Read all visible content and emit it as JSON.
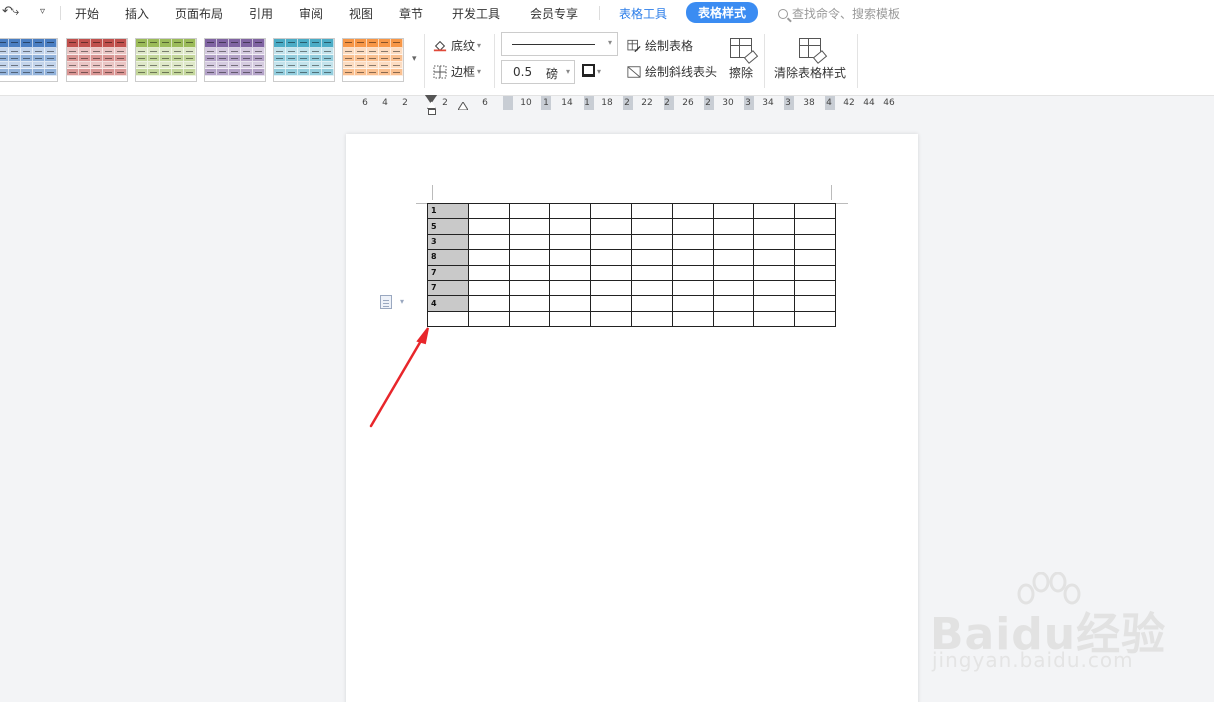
{
  "menu": {
    "items": [
      "开始",
      "插入",
      "页面布局",
      "引用",
      "审阅",
      "视图",
      "章节",
      "开发工具",
      "会员专享"
    ],
    "context_tab": "表格工具",
    "active_tab": "表格样式",
    "search_placeholder": "查找命令、搜索模板"
  },
  "ribbon": {
    "style_colors": [
      "#4a7ec2",
      "#c0504d",
      "#9bbb59",
      "#8064a2",
      "#4bacc6",
      "#f79646"
    ],
    "shading_label": "底纹",
    "border_label": "边框",
    "line_width_value": "0.5",
    "line_width_unit": "磅",
    "draw_table_label": "绘制表格",
    "draw_diagonal_label": "绘制斜线表头",
    "eraser_label": "擦除",
    "clear_style_label": "清除表格样式"
  },
  "ruler": {
    "ticks": [
      "6",
      "4",
      "2",
      "2",
      "6",
      "10",
      "1",
      "14",
      "1",
      "18",
      "2",
      "22",
      "2",
      "26",
      "2",
      "30",
      "3",
      "34",
      "3",
      "38",
      "4",
      "42",
      "44",
      "46"
    ]
  },
  "document": {
    "table": {
      "first_column": [
        "1",
        "5",
        "3",
        "8",
        "7",
        "7",
        "4",
        ""
      ],
      "columns": 10
    }
  },
  "watermark": {
    "brand": "Baidu经验",
    "url": "jingyan.baidu.com"
  }
}
